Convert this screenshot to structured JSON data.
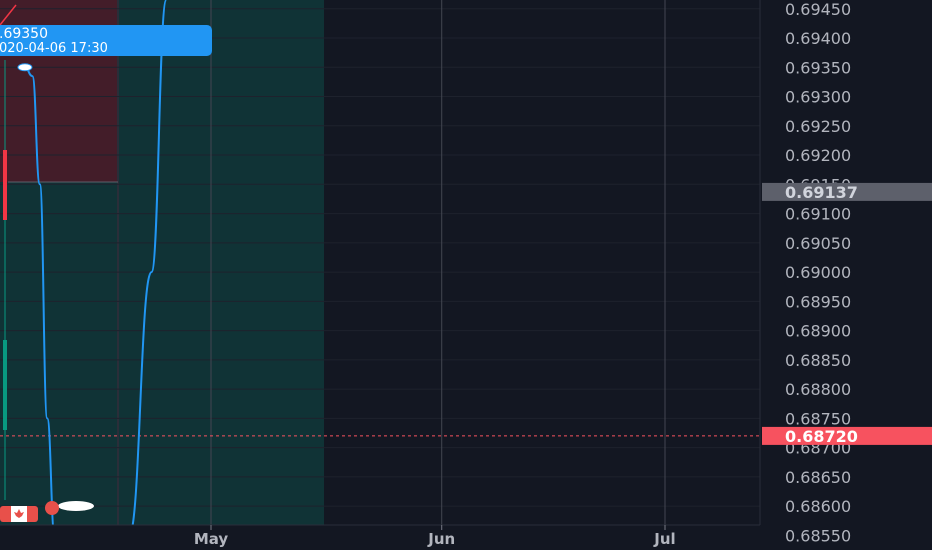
{
  "chart_data": {
    "type": "line",
    "title": "",
    "y_axis": {
      "ylim": [
        0.68525,
        0.69465
      ],
      "ticks": [
        "0.69450",
        "0.69400",
        "0.69350",
        "0.69300",
        "0.69250",
        "0.69200",
        "0.69150",
        "0.69100",
        "0.69050",
        "0.69000",
        "0.68950",
        "0.68900",
        "0.68850",
        "0.68800",
        "0.68750",
        "0.68700",
        "0.68650",
        "0.68600",
        "0.68550"
      ],
      "side": "right"
    },
    "x_axis": {
      "ticks": [
        "May",
        "Jun",
        "Jul"
      ]
    },
    "series": [
      {
        "color": "#2196f3",
        "x": [
          "2020-04-06",
          "2020-04-07",
          "2020-04-08",
          "2020-04-09",
          "2020-04-10",
          "2020-04-20",
          "2020-04-23",
          "2020-04-25"
        ],
        "y": [
          0.6935,
          0.69335,
          0.6915,
          0.6875,
          0.6855,
          0.6855,
          0.69,
          0.69465
        ]
      }
    ],
    "price_line": {
      "value": 0.6872,
      "color": "#f7525f",
      "label": "0.68720"
    },
    "price_tag": {
      "value": 0.69137,
      "label": "0.69137",
      "color": "#5d606b"
    },
    "tooltip": {
      "value": ".69350",
      "date": "020-04-06 17:30",
      "color": "#2196f3"
    },
    "zones": [
      {
        "kind": "stop",
        "color": "rgba(242,54,69,0.22)"
      },
      {
        "kind": "target",
        "color": "rgba(8,153,129,0.22)"
      }
    ],
    "grid": true,
    "legend": "none"
  }
}
